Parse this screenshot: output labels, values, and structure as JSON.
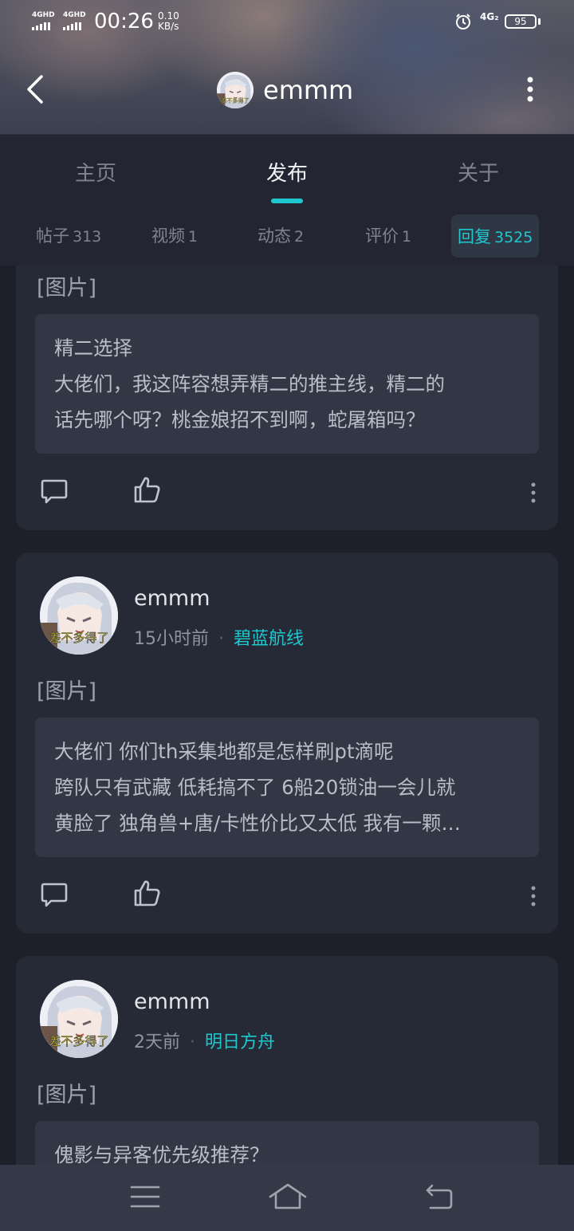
{
  "status_bar": {
    "signal1": "4GHD",
    "signal2": "4GHD",
    "time": "00:26",
    "speed_value": "0.10",
    "speed_unit": "KB/s",
    "network": "4G₂",
    "battery": "95"
  },
  "header": {
    "username": "emmm",
    "avatar_caption": "差不多得了"
  },
  "tabs": [
    {
      "label": "主页"
    },
    {
      "label": "发布"
    },
    {
      "label": "关于"
    }
  ],
  "subtabs": [
    {
      "label": "帖子",
      "count": "313"
    },
    {
      "label": "视频",
      "count": "1"
    },
    {
      "label": "动态",
      "count": "2"
    },
    {
      "label": "评价",
      "count": "1"
    },
    {
      "label": "回复",
      "count": "3525"
    }
  ],
  "posts": [
    {
      "image_tag": "[图片]",
      "quote_lines": [
        "精二选择",
        "大佬们，我这阵容想弄精二的推主线，精二的",
        "话先哪个呀？桃金娘招不到啊，蛇屠箱吗？"
      ]
    },
    {
      "username": "emmm",
      "avatar_caption": "差不多得了",
      "time": "15小时前",
      "separator": "·",
      "board": "碧蓝航线",
      "image_tag": "[图片]",
      "quote_lines": [
        "大佬们 你们th采集地都是怎样刷pt滴呢",
        "跨队只有武藏 低耗搞不了 6船20锁油一会儿就",
        "黄脸了 独角兽+唐/卡性价比又太低  我有一颗…"
      ]
    },
    {
      "username": "emmm",
      "avatar_caption": "差不多得了",
      "time": "2天前",
      "separator": "·",
      "board": "明日方舟",
      "image_tag": "[图片]",
      "quote_lines": [
        "傀影与异客优先级推荐？"
      ]
    }
  ],
  "colors": {
    "accent": "#1fc8cf",
    "background": "#1d2029",
    "card": "#262a36"
  }
}
